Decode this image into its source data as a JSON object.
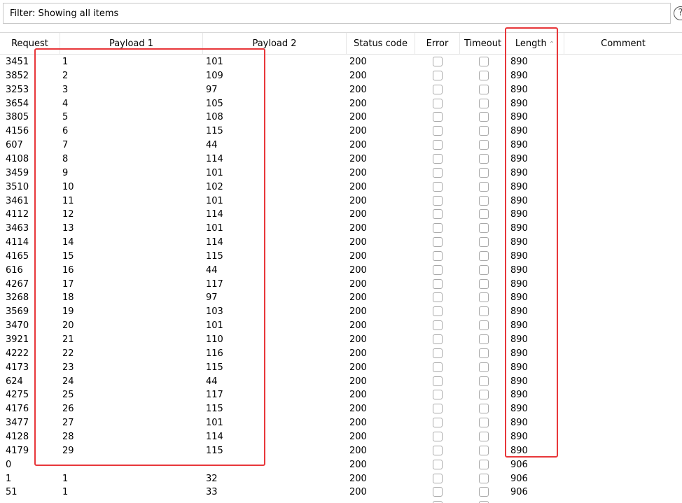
{
  "filter": {
    "label": "Filter: Showing all items",
    "help_icon": "help-icon"
  },
  "columns": [
    {
      "key": "request",
      "label": "Request"
    },
    {
      "key": "payload1",
      "label": "Payload 1"
    },
    {
      "key": "payload2",
      "label": "Payload 2"
    },
    {
      "key": "status",
      "label": "Status code"
    },
    {
      "key": "error",
      "label": "Error"
    },
    {
      "key": "timeout",
      "label": "Timeout"
    },
    {
      "key": "length",
      "label": "Length",
      "sorted": "ascending"
    },
    {
      "key": "comment",
      "label": "Comment"
    }
  ],
  "sort_icon": "sort-ascending-icon",
  "highlight_color": "#e8373a",
  "rows": [
    {
      "request": "3451",
      "payload1": "1",
      "payload2": "101",
      "status": "200",
      "length": "890"
    },
    {
      "request": "3852",
      "payload1": "2",
      "payload2": "109",
      "status": "200",
      "length": "890"
    },
    {
      "request": "3253",
      "payload1": "3",
      "payload2": "97",
      "status": "200",
      "length": "890"
    },
    {
      "request": "3654",
      "payload1": "4",
      "payload2": "105",
      "status": "200",
      "length": "890"
    },
    {
      "request": "3805",
      "payload1": "5",
      "payload2": "108",
      "status": "200",
      "length": "890"
    },
    {
      "request": "4156",
      "payload1": "6",
      "payload2": "115",
      "status": "200",
      "length": "890"
    },
    {
      "request": "607",
      "payload1": "7",
      "payload2": "44",
      "status": "200",
      "length": "890"
    },
    {
      "request": "4108",
      "payload1": "8",
      "payload2": "114",
      "status": "200",
      "length": "890"
    },
    {
      "request": "3459",
      "payload1": "9",
      "payload2": "101",
      "status": "200",
      "length": "890"
    },
    {
      "request": "3510",
      "payload1": "10",
      "payload2": "102",
      "status": "200",
      "length": "890"
    },
    {
      "request": "3461",
      "payload1": "11",
      "payload2": "101",
      "status": "200",
      "length": "890"
    },
    {
      "request": "4112",
      "payload1": "12",
      "payload2": "114",
      "status": "200",
      "length": "890"
    },
    {
      "request": "3463",
      "payload1": "13",
      "payload2": "101",
      "status": "200",
      "length": "890"
    },
    {
      "request": "4114",
      "payload1": "14",
      "payload2": "114",
      "status": "200",
      "length": "890"
    },
    {
      "request": "4165",
      "payload1": "15",
      "payload2": "115",
      "status": "200",
      "length": "890"
    },
    {
      "request": "616",
      "payload1": "16",
      "payload2": "44",
      "status": "200",
      "length": "890"
    },
    {
      "request": "4267",
      "payload1": "17",
      "payload2": "117",
      "status": "200",
      "length": "890"
    },
    {
      "request": "3268",
      "payload1": "18",
      "payload2": "97",
      "status": "200",
      "length": "890"
    },
    {
      "request": "3569",
      "payload1": "19",
      "payload2": "103",
      "status": "200",
      "length": "890"
    },
    {
      "request": "3470",
      "payload1": "20",
      "payload2": "101",
      "status": "200",
      "length": "890"
    },
    {
      "request": "3921",
      "payload1": "21",
      "payload2": "110",
      "status": "200",
      "length": "890"
    },
    {
      "request": "4222",
      "payload1": "22",
      "payload2": "116",
      "status": "200",
      "length": "890"
    },
    {
      "request": "4173",
      "payload1": "23",
      "payload2": "115",
      "status": "200",
      "length": "890"
    },
    {
      "request": "624",
      "payload1": "24",
      "payload2": "44",
      "status": "200",
      "length": "890"
    },
    {
      "request": "4275",
      "payload1": "25",
      "payload2": "117",
      "status": "200",
      "length": "890"
    },
    {
      "request": "4176",
      "payload1": "26",
      "payload2": "115",
      "status": "200",
      "length": "890"
    },
    {
      "request": "3477",
      "payload1": "27",
      "payload2": "101",
      "status": "200",
      "length": "890"
    },
    {
      "request": "4128",
      "payload1": "28",
      "payload2": "114",
      "status": "200",
      "length": "890"
    },
    {
      "request": "4179",
      "payload1": "29",
      "payload2": "115",
      "status": "200",
      "length": "890"
    },
    {
      "request": "0",
      "payload1": "",
      "payload2": "",
      "status": "200",
      "length": "906"
    },
    {
      "request": "1",
      "payload1": "1",
      "payload2": "32",
      "status": "200",
      "length": "906"
    },
    {
      "request": "51",
      "payload1": "1",
      "payload2": "33",
      "status": "200",
      "length": "906"
    },
    {
      "request": "",
      "payload1": "",
      "payload2": "",
      "status": "",
      "length": ""
    }
  ]
}
